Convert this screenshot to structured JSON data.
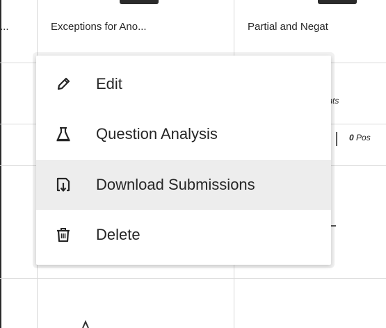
{
  "table": {
    "columns": [
      {
        "label": "..."
      },
      {
        "label": "Exceptions for Ano..."
      },
      {
        "label": "Partial and Negat"
      }
    ],
    "fragments": {
      "points_label": "oints",
      "possible_value": "0",
      "possible_label": "Pos"
    }
  },
  "context_menu": {
    "items": [
      {
        "label": "Edit",
        "icon": "pencil-icon"
      },
      {
        "label": "Question Analysis",
        "icon": "flask-icon"
      },
      {
        "label": "Download Submissions",
        "icon": "download-icon"
      },
      {
        "label": "Delete",
        "icon": "trash-icon"
      }
    ],
    "hovered_item": "Download Submissions"
  }
}
